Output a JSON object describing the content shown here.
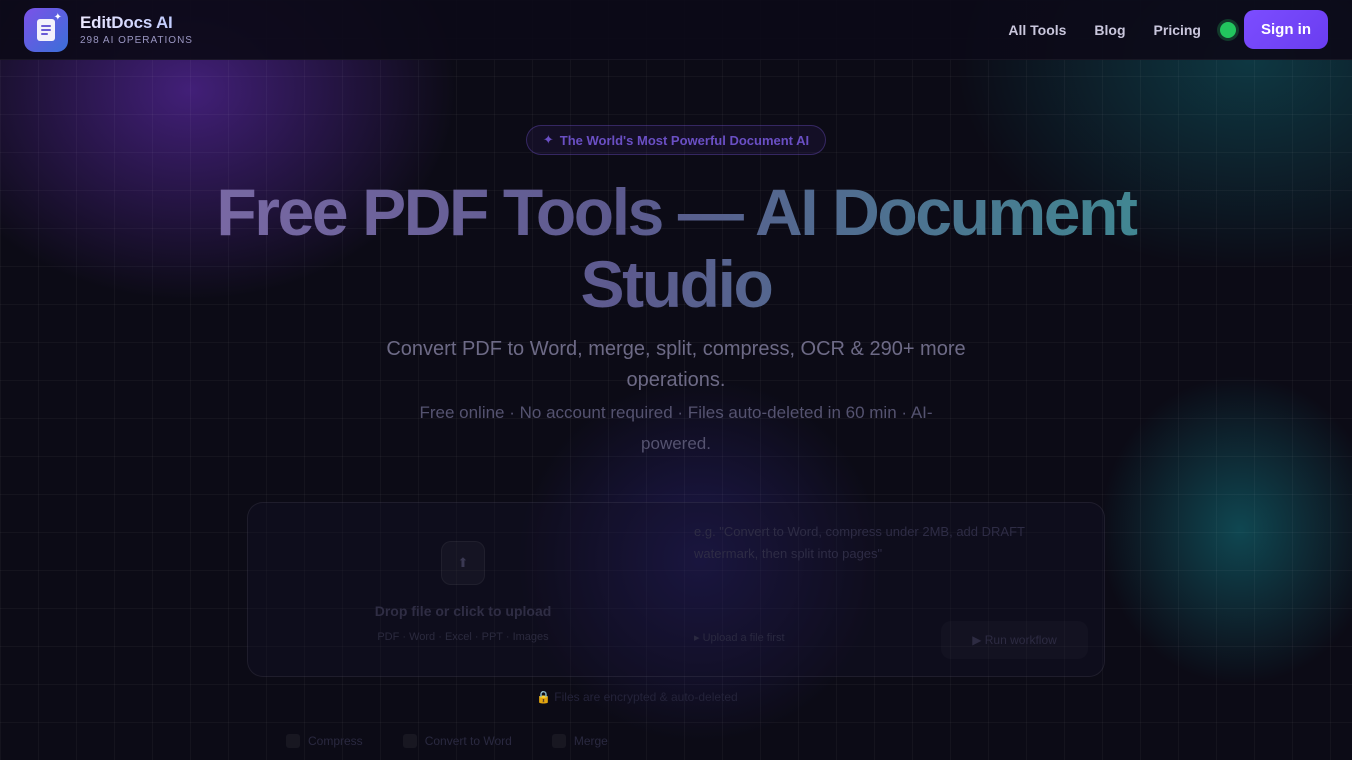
{
  "brand": {
    "name": "EditDocs AI",
    "tagline": "298 AI OPERATIONS"
  },
  "nav": {
    "items": [
      {
        "label": "All Tools"
      },
      {
        "label": "Blog"
      },
      {
        "label": "Pricing"
      }
    ],
    "signin_label": "Sign in"
  },
  "hero": {
    "badge": "The World's Most Powerful Document AI",
    "title_line1": "Free PDF Tools — AI Document",
    "title_line2": "Studio",
    "subtitle": "Convert PDF to Word, merge, split, compress, OCR & 290+ more operations.",
    "note": "Free online · No account required · Files auto-deleted in 60 min · AI-powered."
  },
  "upload": {
    "drop_title": "Drop file or click to upload",
    "drop_types": "PDF · Word · Excel · PPT · Images",
    "prompt_placeholder": "e.g. \"Convert to Word, compress under 2MB, add DRAFT watermark, then split into pages\"",
    "hint": "▸ Upload a file first",
    "run_label": "▶ Run workflow"
  },
  "privacy": "🔒 Files are encrypted & auto-deleted",
  "quick_tools": [
    {
      "label": "Compress"
    },
    {
      "label": "Convert to Word"
    },
    {
      "label": "Merge"
    }
  ],
  "colors": {
    "accent": "#7c4dff",
    "status": "#22c55e",
    "background": "#0c0b16"
  }
}
